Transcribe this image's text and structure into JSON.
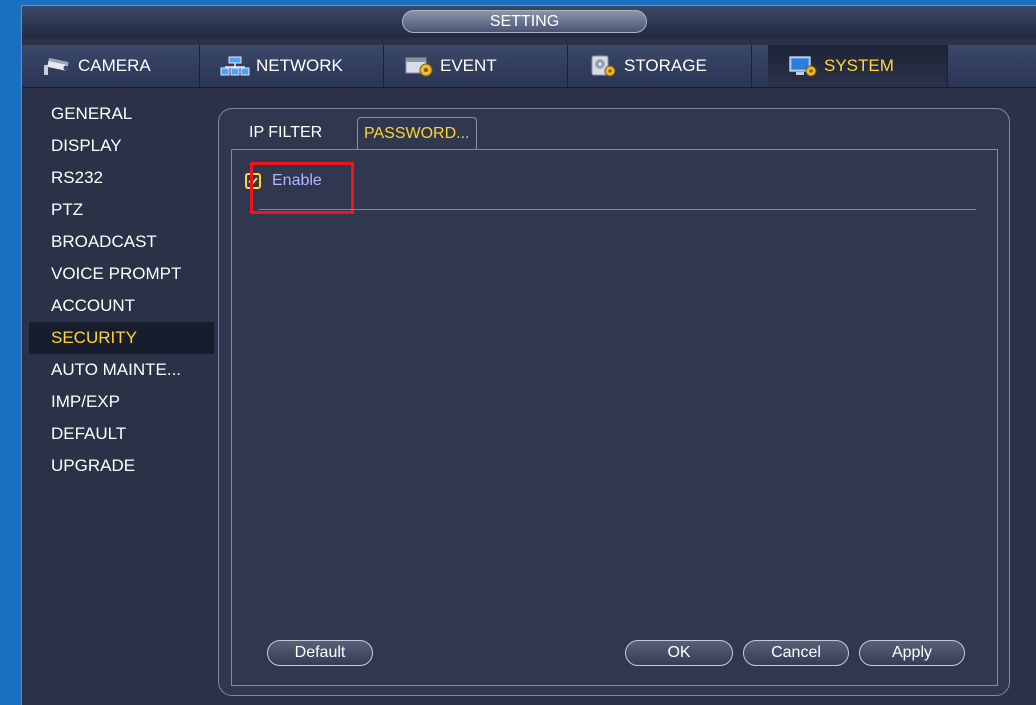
{
  "window": {
    "title": "SETTING"
  },
  "main_tabs": [
    {
      "label": "CAMERA",
      "icon": "camera-icon"
    },
    {
      "label": "NETWORK",
      "icon": "network-icon"
    },
    {
      "label": "EVENT",
      "icon": "event-icon"
    },
    {
      "label": "STORAGE",
      "icon": "storage-icon"
    },
    {
      "label": "SYSTEM",
      "icon": "system-icon",
      "active": true
    }
  ],
  "sidebar": {
    "items": [
      {
        "label": "GENERAL"
      },
      {
        "label": "DISPLAY"
      },
      {
        "label": "RS232"
      },
      {
        "label": "PTZ"
      },
      {
        "label": "BROADCAST"
      },
      {
        "label": "VOICE PROMPT"
      },
      {
        "label": "ACCOUNT"
      },
      {
        "label": "SECURITY",
        "active": true
      },
      {
        "label": "AUTO MAINTE..."
      },
      {
        "label": "IMP/EXP"
      },
      {
        "label": "DEFAULT"
      },
      {
        "label": "UPGRADE"
      }
    ]
  },
  "sub_tabs": [
    {
      "label": "IP FILTER"
    },
    {
      "label": "PASSWORD...",
      "active": true
    }
  ],
  "password": {
    "enable_label": "Enable",
    "enable_checked": true
  },
  "buttons": {
    "default_label": "Default",
    "ok_label": "OK",
    "cancel_label": "Cancel",
    "apply_label": "Apply"
  },
  "colors": {
    "accent": "#ffd633",
    "highlight": "#f0141e",
    "desktop": "#1b6fc0",
    "panel": "#2b3146"
  }
}
